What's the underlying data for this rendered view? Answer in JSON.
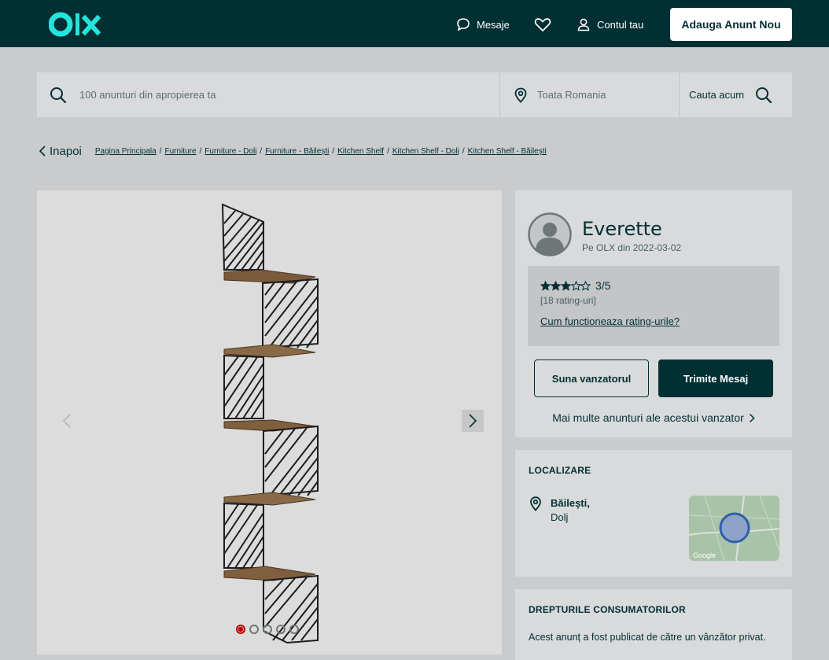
{
  "header": {
    "logo_text": "OLX",
    "messages_label": "Mesaje",
    "account_label": "Contul tau",
    "add_listing_label": "Adauga Anunt Nou"
  },
  "search": {
    "query_placeholder": "100 anunturi din apropierea ta",
    "location_placeholder": "Toata Romania",
    "submit_label": "Cauta acum"
  },
  "breadcrumb": {
    "back_label": "Inapoi",
    "items": [
      "Pagina Principala",
      "Furniture",
      "Furniture - Dolj",
      "Furniture - Băilești",
      "Kitchen Shelf",
      "Kitchen Shelf - Dolj",
      "Kitchen Shelf - Băilești"
    ]
  },
  "gallery": {
    "image_count": 5,
    "active_index": 0
  },
  "seller": {
    "name": "Everette",
    "member_since": "Pe OLX din 2022-03-02",
    "rating_value": 3,
    "rating_max": 5,
    "rating_text": "3/5",
    "rating_count": "[18 rating-uri]",
    "rating_help_link": "Cum functioneaza rating-urile?",
    "call_button": "Suna vanzatorul",
    "message_button": "Trimite Mesaj",
    "more_ads_link": "Mai multe anunturi ale acestui vanzator"
  },
  "location": {
    "title": "LOCALIZARE",
    "city": "Băilești,",
    "county": "Dolj",
    "map_label": "Google"
  },
  "consumer_rights": {
    "title": "DREPTURILE CONSUMATORILOR",
    "text": "Acest anunț a fost publicat de către un vânzător privat."
  },
  "colors": {
    "brand_dark": "#002f34",
    "brand_teal": "#23e5db",
    "active_dot": "#c00000"
  }
}
